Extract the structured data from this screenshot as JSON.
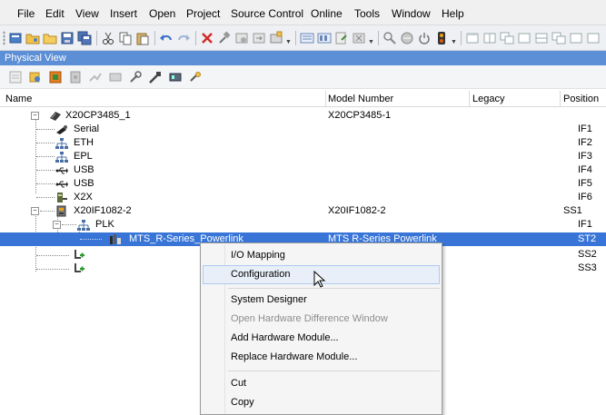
{
  "menubar": {
    "items": [
      "File",
      "Edit",
      "View",
      "Insert",
      "Open",
      "Project",
      "Source Control",
      "Online",
      "Tools",
      "Window",
      "Help"
    ]
  },
  "toolbar": {
    "icons": [
      "new-project-icon",
      "open-project-icon",
      "open-file-icon",
      "save-icon",
      "save-all-icon",
      "cut-icon",
      "copy-icon",
      "paste-icon",
      "undo-icon",
      "redo-icon",
      "delete-icon",
      "build-icon",
      "rebuild-icon",
      "transfer-icon",
      "configuration-icon",
      "hardware-tree-icon",
      "system-designer-icon",
      "export-icon",
      "tools-icon",
      "search-icon",
      "online-icon",
      "power-icon",
      "stop-icon",
      "window-icon",
      "window-split-icon",
      "window-float-icon"
    ]
  },
  "panel": {
    "title": "Physical View",
    "toolbar_icons": [
      "view-icon",
      "search-tree-icon",
      "module-icon",
      "filter-icon",
      "connection-icon",
      "network-icon",
      "probe-icon",
      "wrench-icon",
      "hardware-icon",
      "settings-icon"
    ]
  },
  "columns": {
    "name": "Name",
    "model": "Model Number",
    "legacy": "Legacy",
    "position": "Position"
  },
  "tree": [
    {
      "name": "X20CP3485_1",
      "model": "X20CP3485-1",
      "legacy": "",
      "position": ""
    },
    {
      "name": "Serial",
      "model": "",
      "legacy": "",
      "position": "IF1"
    },
    {
      "name": "ETH",
      "model": "",
      "legacy": "",
      "position": "IF2"
    },
    {
      "name": "EPL",
      "model": "",
      "legacy": "",
      "position": "IF3"
    },
    {
      "name": "USB",
      "model": "",
      "legacy": "",
      "position": "IF4"
    },
    {
      "name": "USB",
      "model": "",
      "legacy": "",
      "position": "IF5"
    },
    {
      "name": "X2X",
      "model": "",
      "legacy": "",
      "position": "IF6"
    },
    {
      "name": "X20IF1082-2",
      "model": "X20IF1082-2",
      "legacy": "",
      "position": "SS1"
    },
    {
      "name": "PLK",
      "model": "",
      "legacy": "",
      "position": "IF1"
    },
    {
      "name": "MTS_R-Series_Powerlink",
      "model": "MTS R-Series Powerlink",
      "legacy": "",
      "position": "ST2"
    },
    {
      "name": "",
      "model": "",
      "legacy": "",
      "position": "SS2"
    },
    {
      "name": "",
      "model": "",
      "legacy": "",
      "position": "SS3"
    }
  ],
  "context_menu": {
    "items": [
      {
        "label": "I/O Mapping",
        "enabled": true
      },
      {
        "label": "Configuration",
        "enabled": true
      },
      {
        "label": "System Designer",
        "enabled": true
      },
      {
        "label": "Open Hardware Difference Window",
        "enabled": false
      },
      {
        "label": "Add Hardware Module...",
        "enabled": true
      },
      {
        "label": "Replace Hardware Module...",
        "enabled": true
      },
      {
        "label": "Cut",
        "enabled": true
      },
      {
        "label": "Copy",
        "enabled": true
      }
    ]
  },
  "colors": {
    "panel_title_bg": "#5c8fd6",
    "selection_bg": "#3875d7",
    "menu_hover_bg": "#e8eff9"
  }
}
